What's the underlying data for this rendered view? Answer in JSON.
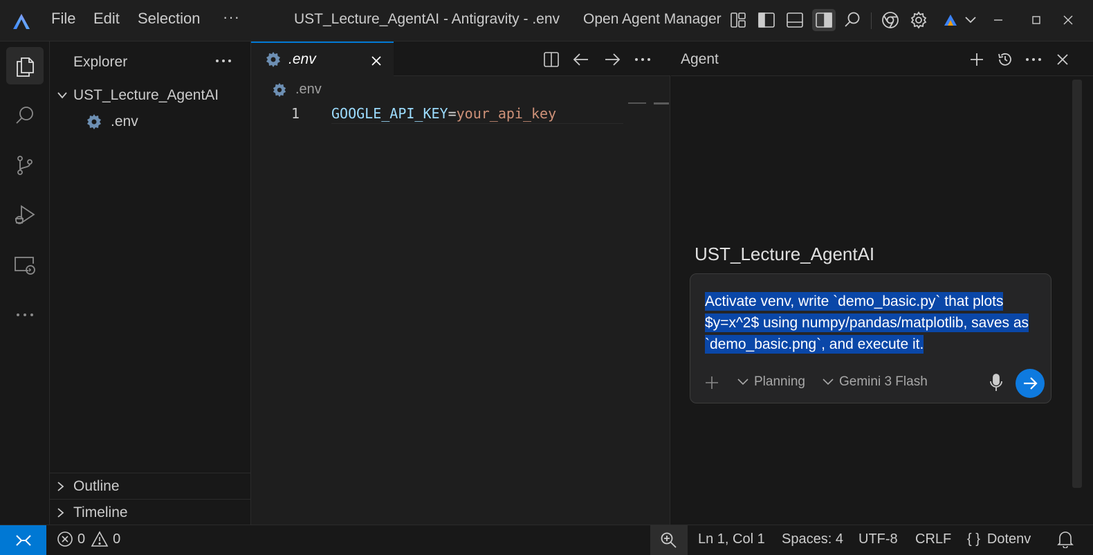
{
  "titlebar": {
    "menus": [
      "File",
      "Edit",
      "Selection"
    ],
    "more": "···",
    "title": "UST_Lecture_AgentAI - Antigravity - .env",
    "open_agent_manager": "Open Agent Manager"
  },
  "activitybar": {
    "items": [
      "explorer-icon",
      "search-icon",
      "source-control-icon",
      "run-debug-icon",
      "remote-explorer-icon",
      "more-icon"
    ]
  },
  "sidebar": {
    "title": "Explorer",
    "folder": "UST_Lecture_AgentAI",
    "files": [
      ".env"
    ],
    "sections": [
      "Outline",
      "Timeline"
    ]
  },
  "editor": {
    "tab_label": ".env",
    "breadcrumb": ".env",
    "line_number": "1",
    "code": {
      "key": "GOOGLE_API_KEY",
      "eq": "=",
      "value": "your_api_key"
    }
  },
  "agent": {
    "title": "Agent",
    "workspace": "UST_Lecture_AgentAI",
    "prompt": "Activate venv, write `demo_basic.py` that plots $y=x^2$ using numpy/pandas/matplotlib, saves as `demo_basic.png`, and execute it.",
    "mode": "Planning",
    "model": "Gemini 3 Flash"
  },
  "statusbar": {
    "errors": "0",
    "warnings": "0",
    "position": "Ln 1, Col 1",
    "spaces": "Spaces: 4",
    "encoding": "UTF-8",
    "eol": "CRLF",
    "language_braces": "{ }",
    "language": "Dotenv"
  },
  "colors": {
    "accent": "#0078d4",
    "send_button": "#0e7adf",
    "selection": "#0a47a8",
    "code_key": "#9cdcfe",
    "code_value": "#ce9178"
  }
}
